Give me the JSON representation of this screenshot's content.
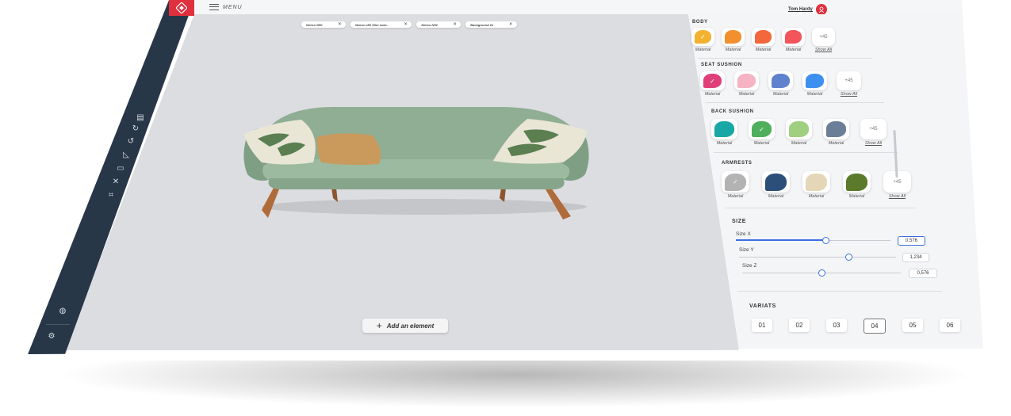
{
  "app": {
    "menu_label": "MENU",
    "user_name": "Tom Hardy"
  },
  "tabs": [
    {
      "label": "Neeso N50"
    },
    {
      "label": "Neeso n50 Slim seas.."
    },
    {
      "label": "Neeso N50"
    },
    {
      "label": "Background 01"
    }
  ],
  "tools": [
    {
      "icon": "calendar-icon"
    },
    {
      "icon": "redo-icon"
    },
    {
      "icon": "undo-icon"
    },
    {
      "icon": "ruler-icon"
    },
    {
      "icon": "image-icon"
    },
    {
      "icon": "move-icon"
    },
    {
      "icon": "crop-icon"
    },
    {
      "icon": "bulb-icon"
    },
    {
      "icon": "gear-icon"
    }
  ],
  "canvas": {
    "add_button": "Add an element"
  },
  "sections": {
    "body": {
      "title": "BODY",
      "swatches": [
        {
          "label": "Material",
          "color": "#f2b230",
          "selected": true
        },
        {
          "label": "Material",
          "color": "#f3902e",
          "selected": false
        },
        {
          "label": "Material",
          "color": "#f4663b",
          "selected": false
        },
        {
          "label": "Material",
          "color": "#f2555a",
          "selected": false
        }
      ],
      "more": "+45",
      "show_all": "Show All"
    },
    "seat": {
      "title": "SEAT SUSHION",
      "swatches": [
        {
          "label": "Material",
          "color": "#e04078",
          "selected": true
        },
        {
          "label": "Material",
          "color": "#f6b3c4",
          "selected": false
        },
        {
          "label": "Material",
          "color": "#5f82cf",
          "selected": false
        },
        {
          "label": "Material",
          "color": "#3d8ff0",
          "selected": false
        }
      ],
      "more": "+45",
      "show_all": "Show All"
    },
    "back": {
      "title": "BACK SUSHION",
      "swatches": [
        {
          "label": "Material",
          "color": "#18a7a5",
          "selected": false
        },
        {
          "label": "Material",
          "color": "#4eaf5c",
          "selected": true
        },
        {
          "label": "Material",
          "color": "#9fd07f",
          "selected": false
        },
        {
          "label": "Material",
          "color": "#6a7f97",
          "selected": false
        }
      ],
      "more": "+45",
      "show_all": "Show All"
    },
    "armrests": {
      "title": "ARMRESTS",
      "swatches": [
        {
          "label": "Material",
          "color": "#b3b3b3",
          "selected": true
        },
        {
          "label": "Material",
          "color": "#2c4f7a",
          "selected": false
        },
        {
          "label": "Material",
          "color": "#e3d7b8",
          "selected": false
        },
        {
          "label": "Material",
          "color": "#5b7a2c",
          "selected": false
        }
      ],
      "more": "+45",
      "show_all": "Show All"
    },
    "size": {
      "title": "SIZE",
      "sliders": [
        {
          "label": "Size X",
          "value": "0,576",
          "level": 0.58,
          "active": true
        },
        {
          "label": "Size Y",
          "value": "1,234",
          "level": 0.7,
          "active": false
        },
        {
          "label": "Size Z",
          "value": "0,576",
          "level": 0.5,
          "active": false
        }
      ]
    },
    "variants": {
      "title": "VARIATS",
      "items": [
        "01",
        "02",
        "03",
        "04",
        "05",
        "06"
      ],
      "selected": "04"
    }
  }
}
